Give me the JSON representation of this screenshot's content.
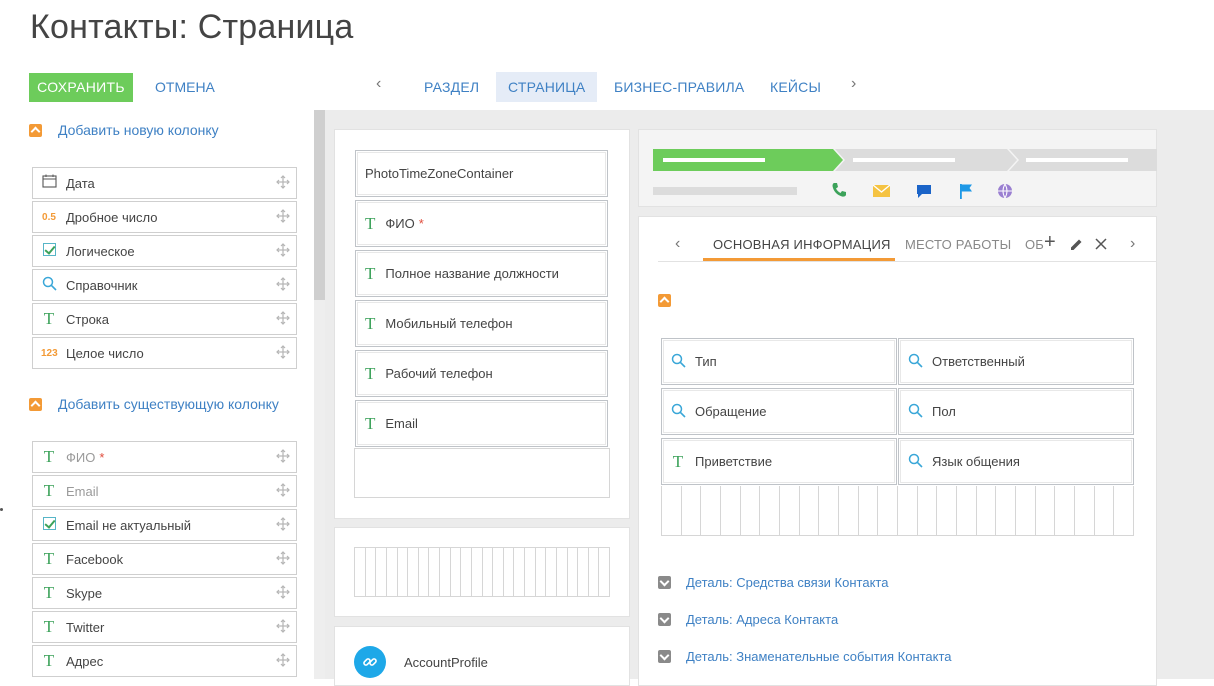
{
  "title": "Контакты: Страница",
  "actions": {
    "save": "СОХРАНИТЬ",
    "cancel": "ОТМЕНА"
  },
  "nav_tabs": [
    {
      "label": "РАЗДЕЛ",
      "active": false
    },
    {
      "label": "СТРАНИЦА",
      "active": true
    },
    {
      "label": "БИЗНЕС-ПРАВИЛА",
      "active": false
    },
    {
      "label": "КЕЙСЫ",
      "active": false
    }
  ],
  "new_columns": {
    "header": "Добавить новую колонку",
    "items": [
      {
        "label": "Дата",
        "icon": "calendar-icon"
      },
      {
        "label": "Дробное число",
        "icon": "decimal-icon",
        "icon_text": "0.5"
      },
      {
        "label": "Логическое",
        "icon": "checkbox-icon"
      },
      {
        "label": "Справочник",
        "icon": "lookup-icon"
      },
      {
        "label": "Строка",
        "icon": "text-icon",
        "icon_text": "T"
      },
      {
        "label": "Целое число",
        "icon": "integer-icon",
        "icon_text": "123"
      }
    ]
  },
  "existing_columns": {
    "header": "Добавить существующую колонку",
    "items": [
      {
        "label": "ФИО",
        "icon": "text-icon",
        "required": "*",
        "dim": true
      },
      {
        "label": "Email",
        "icon": "text-icon",
        "dim": true
      },
      {
        "label": "Email не актуальный",
        "icon": "checkbox-icon"
      },
      {
        "label": "Facebook",
        "icon": "text-icon"
      },
      {
        "label": "Skype",
        "icon": "text-icon"
      },
      {
        "label": "Twitter",
        "icon": "text-icon"
      },
      {
        "label": "Адрес",
        "icon": "text-icon"
      }
    ]
  },
  "profile_fields": [
    {
      "label": "PhotoTimeZoneContainer",
      "icon": ""
    },
    {
      "label": "ФИО",
      "icon": "text-icon",
      "required": "*"
    },
    {
      "label": "Полное название должности",
      "icon": "text-icon"
    },
    {
      "label": "Мобильный телефон",
      "icon": "text-icon"
    },
    {
      "label": "Рабочий телефон",
      "icon": "text-icon"
    },
    {
      "label": "Email",
      "icon": "text-icon"
    }
  ],
  "account_profile": "AccountProfile",
  "content_tabs": [
    {
      "label": "ОСНОВНАЯ ИНФОРМАЦИЯ",
      "active": true
    },
    {
      "label": "МЕСТО РАБОТЫ",
      "active": false
    },
    {
      "label": "ОБ",
      "active": false
    }
  ],
  "main_fields": [
    {
      "label": "Тип",
      "icon": "lookup-icon"
    },
    {
      "label": "Ответственный",
      "icon": "lookup-icon"
    },
    {
      "label": "Обращение",
      "icon": "lookup-icon"
    },
    {
      "label": "Пол",
      "icon": "lookup-icon"
    },
    {
      "label": "Приветствие",
      "icon": "text-icon"
    },
    {
      "label": "Язык общения",
      "icon": "lookup-icon"
    }
  ],
  "details": [
    "Деталь: Средства связи Контакта",
    "Деталь: Адреса Контакта",
    "Деталь: Знаменательные события Контакта"
  ],
  "colors": {
    "save_green": "#6dcc5b",
    "link_blue": "#3f81c4",
    "accent_orange": "#f39a36",
    "text_green": "#3ca25a",
    "progress_green": "#6dcc5b"
  }
}
